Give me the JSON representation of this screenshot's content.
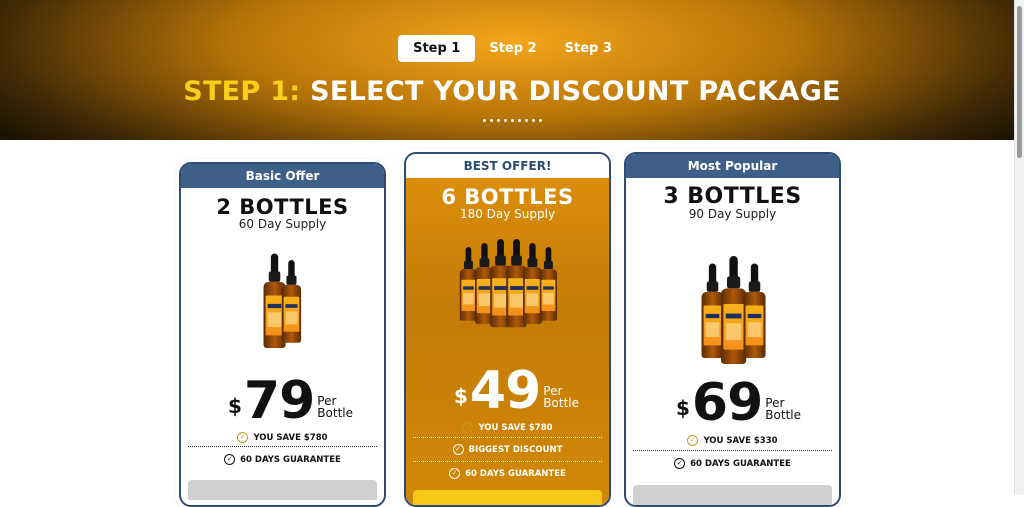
{
  "steps": [
    {
      "label": "Step 1",
      "active": true
    },
    {
      "label": "Step 2",
      "active": false
    },
    {
      "label": "Step 3",
      "active": false
    }
  ],
  "headline": {
    "highlight": "STEP 1:",
    "rest": "SELECT YOUR DISCOUNT PACKAGE"
  },
  "colors": {
    "accent_yellow": "#f7d01b",
    "card_header": "#3e5f87",
    "best_bg": "#c27b07",
    "cta_best": "#f7c81a"
  },
  "packages": [
    {
      "header": "Basic Offer",
      "title": "2 BOTTLES",
      "supply": "60 Day Supply",
      "bottles_shown": 2,
      "currency": "$",
      "price": "79",
      "per_line1": "Per",
      "per_line2": "Bottle",
      "features": [
        {
          "icon": "check-circle-icon",
          "text": "YOU SAVE $780",
          "style": "gold"
        },
        {
          "icon": "check-circle-icon",
          "text": "60 DAYS GUARANTEE",
          "style": "plain"
        }
      ]
    },
    {
      "header": "BEST OFFER!",
      "title": "6 BOTTLES",
      "supply": "180 Day Supply",
      "bottles_shown": 6,
      "currency": "$",
      "price": "49",
      "per_line1": "Per",
      "per_line2": "Bottle",
      "features": [
        {
          "icon": "check-circle-icon",
          "text": "YOU SAVE $780",
          "style": "gold"
        },
        {
          "icon": "check-circle-icon",
          "text": "BIGGEST DISCOUNT",
          "style": "plain"
        },
        {
          "icon": "check-circle-icon",
          "text": "60 DAYS GUARANTEE",
          "style": "plain"
        }
      ]
    },
    {
      "header": "Most Popular",
      "title": "3 BOTTLES",
      "supply": "90 Day Supply",
      "bottles_shown": 3,
      "currency": "$",
      "price": "69",
      "per_line1": "Per",
      "per_line2": "Bottle",
      "features": [
        {
          "icon": "check-circle-icon",
          "text": "YOU SAVE $330",
          "style": "gold"
        },
        {
          "icon": "check-circle-icon",
          "text": "60 DAYS GUARANTEE",
          "style": "plain"
        }
      ]
    }
  ]
}
